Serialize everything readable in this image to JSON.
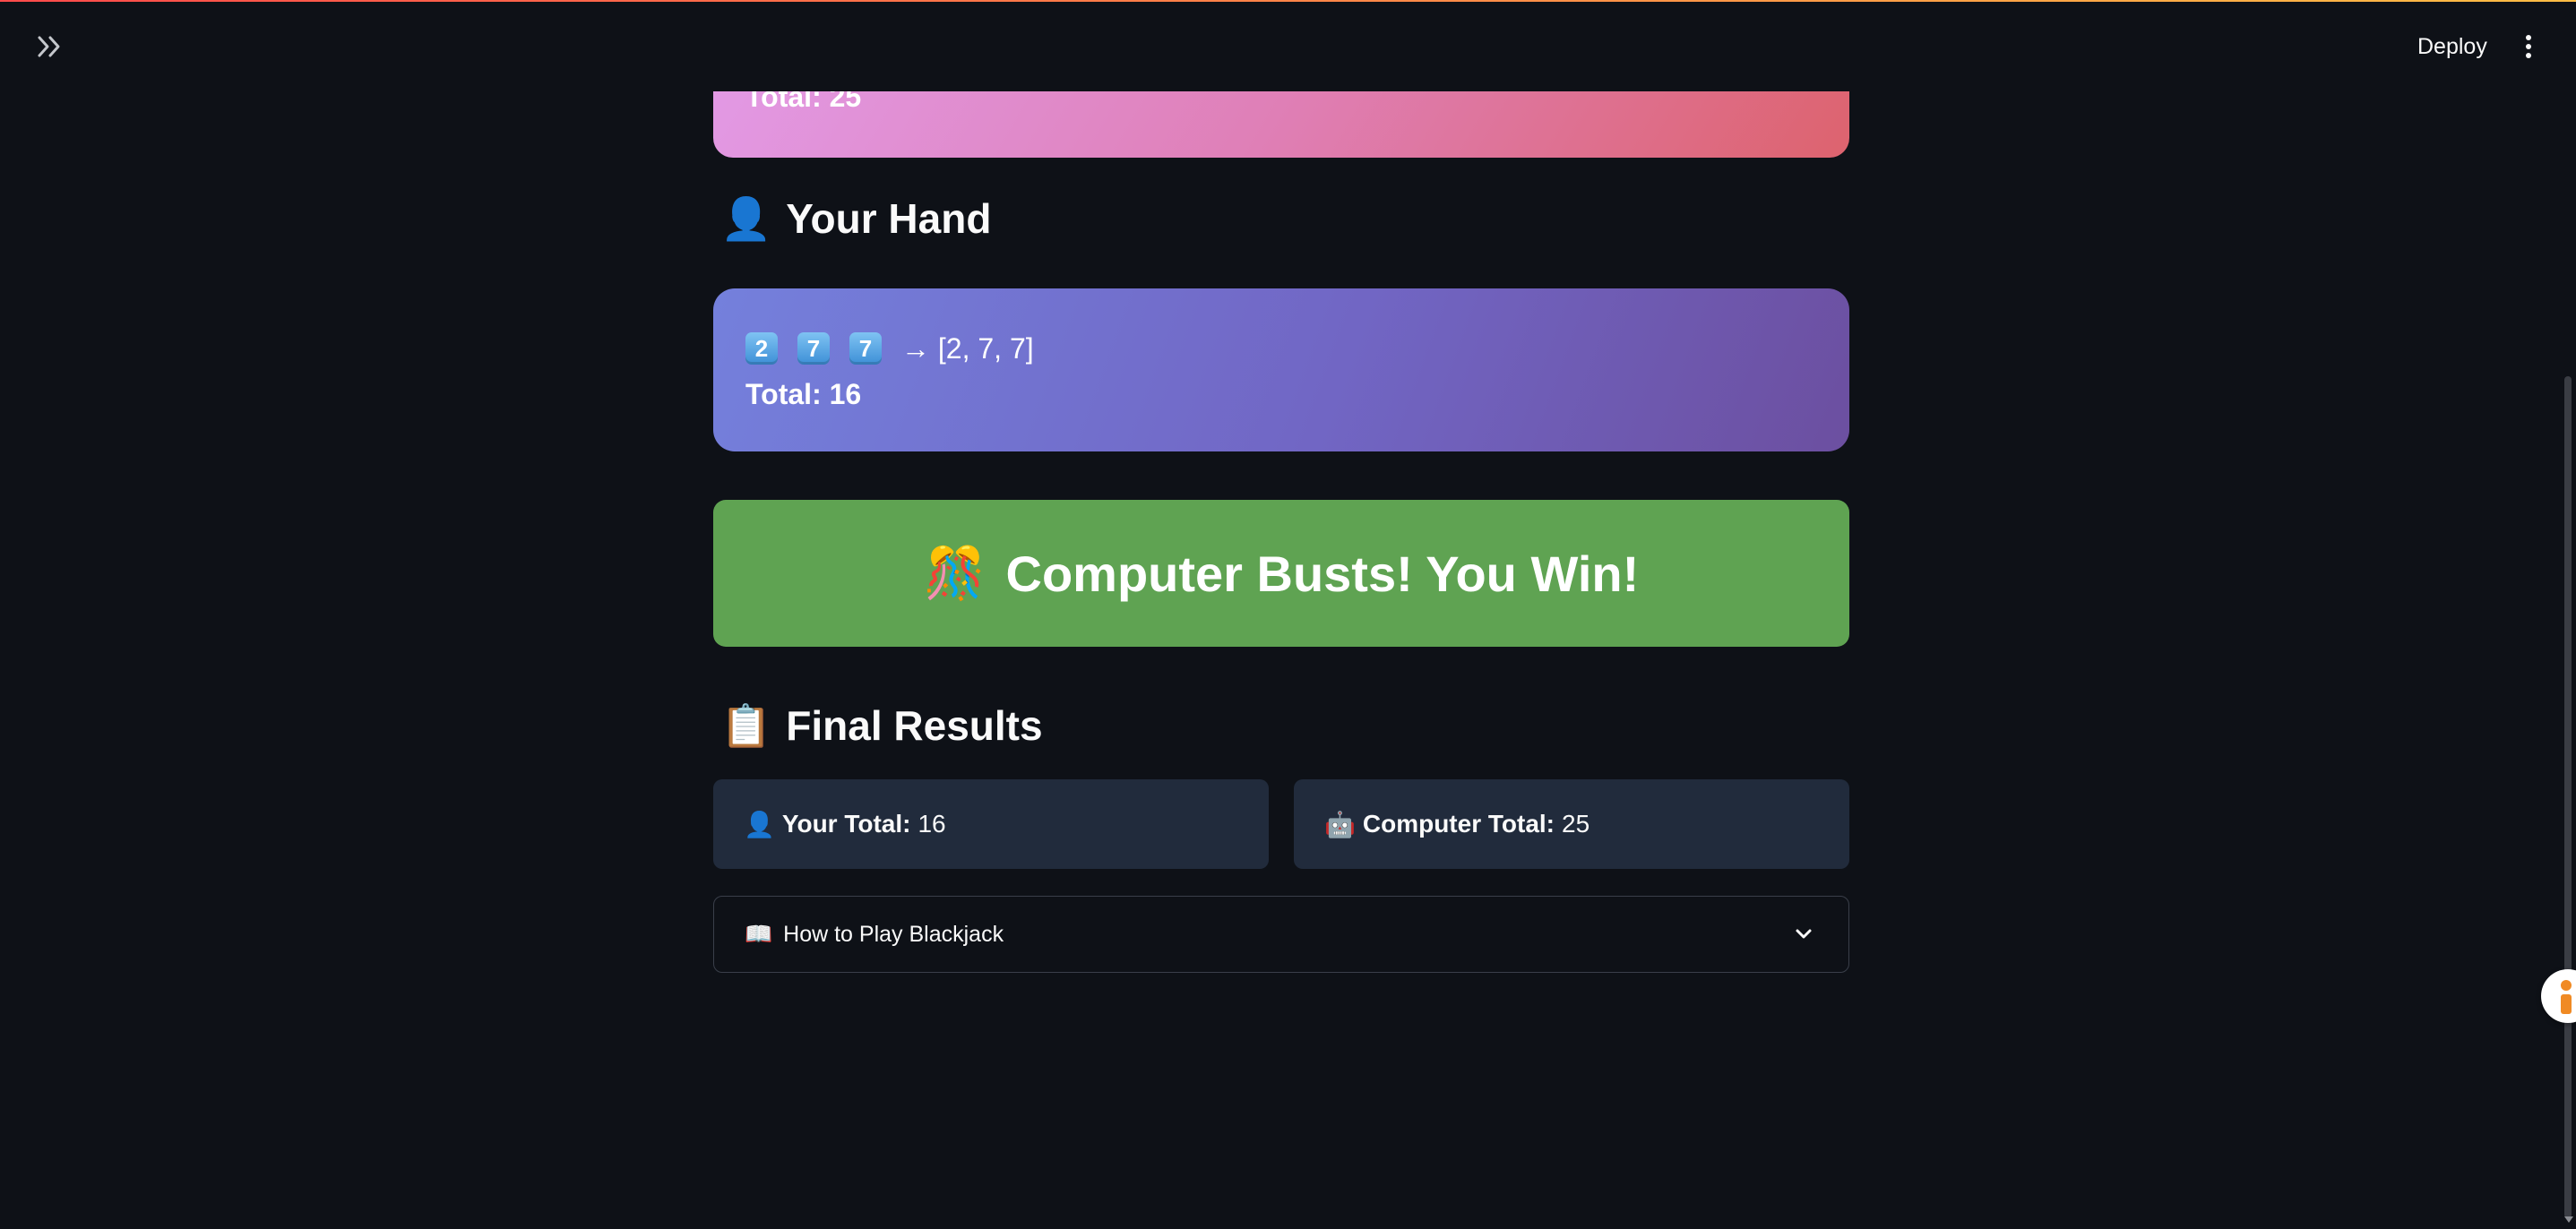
{
  "header": {
    "deploy_label": "Deploy",
    "sidebar_toggle_icon": "double-chevron-right-icon",
    "menu_icon": "vertical-dots-icon"
  },
  "computer_hand": {
    "total_text": "Total: 25"
  },
  "player_hand": {
    "heading_emoji": "👤",
    "heading": "Your Hand",
    "card_keycaps": [
      "2",
      "7",
      "7"
    ],
    "card_values_text": "→ [2, 7, 7]",
    "total_text": "Total: 16"
  },
  "result": {
    "emoji": "🎊",
    "text": "Computer Busts! You Win!",
    "color": "#5fa352"
  },
  "final_results": {
    "heading_emoji": "📋",
    "heading": "Final Results",
    "your_total": {
      "emoji": "👤",
      "label": "Your Total:",
      "value": "16"
    },
    "computer_total": {
      "emoji": "🤖",
      "label": "Computer Total:",
      "value": "25"
    }
  },
  "expander": {
    "emoji": "📖",
    "label": "How to Play Blackjack",
    "icon": "chevron-down-icon"
  }
}
